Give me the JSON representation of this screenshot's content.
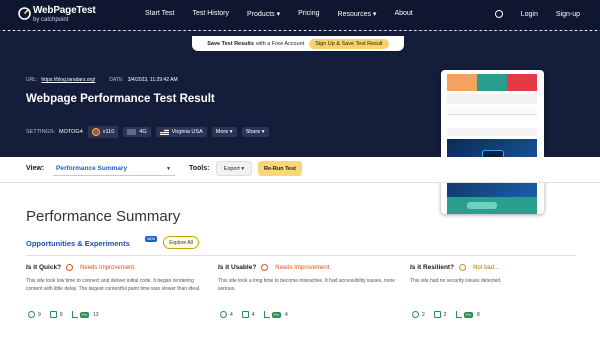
{
  "nav": {
    "logo_title": "WebPageTest",
    "logo_sub": "by catchpoint",
    "links": [
      "Start Test",
      "Test History",
      "Products ▾",
      "Pricing",
      "Resources ▾",
      "About"
    ],
    "login": "Login",
    "signup": "Sign-up"
  },
  "banner": {
    "bold": "Save Test Results",
    "text": "with a Free Account",
    "button": "Sign Up & Save Test Result"
  },
  "test": {
    "url_label": "URL:",
    "url": "https://blog.laradars.org/",
    "date_label": "DATE:",
    "date": "3/4/2023, 11:29:42 AM",
    "title": "Webpage Performance Test Result"
  },
  "settings": {
    "label": "SETTINGS:",
    "device": "MOTOG4",
    "browser": "v110",
    "connection": "4G",
    "location": "Virginia USA",
    "more": "More ▾",
    "share": "Share ▾"
  },
  "toolbar": {
    "view_label": "View:",
    "view_value": "Performance Summary",
    "tools_label": "Tools:",
    "export": "Export ▾",
    "rerun": "Re-Run Test"
  },
  "summary": {
    "heading": "Performance Summary",
    "opportunities": "Opportunities & Experiments",
    "new_badge": "NEW",
    "explore": "Explore All",
    "columns": [
      {
        "question": "Is it Quick?",
        "status": "Needs Improvement.",
        "description": "This site took low time to connect and deliver initial code. It began rendering content with little delay. The largest contentful paint time was slower than ideal.",
        "counts": [
          "9",
          "9",
          "13"
        ]
      },
      {
        "question": "Is it Usable?",
        "status": "Needs Improvement.",
        "description": "This site took a long time to become interactive. It had accessibility issues, none serious.",
        "counts": [
          "4",
          "4",
          "4"
        ]
      },
      {
        "question": "Is it Resilient?",
        "status": "Not bad...",
        "description": "This site had no security issues detected.",
        "counts": [
          "2",
          "2",
          "8"
        ]
      }
    ],
    "pro_label": "Pro"
  },
  "colors": {
    "nav_bg": "#0e1630",
    "header_bg": "#141e3a",
    "accent_yellow": "#fad776",
    "link_blue": "#1f5fc9",
    "warn_orange": "#d4581b"
  }
}
